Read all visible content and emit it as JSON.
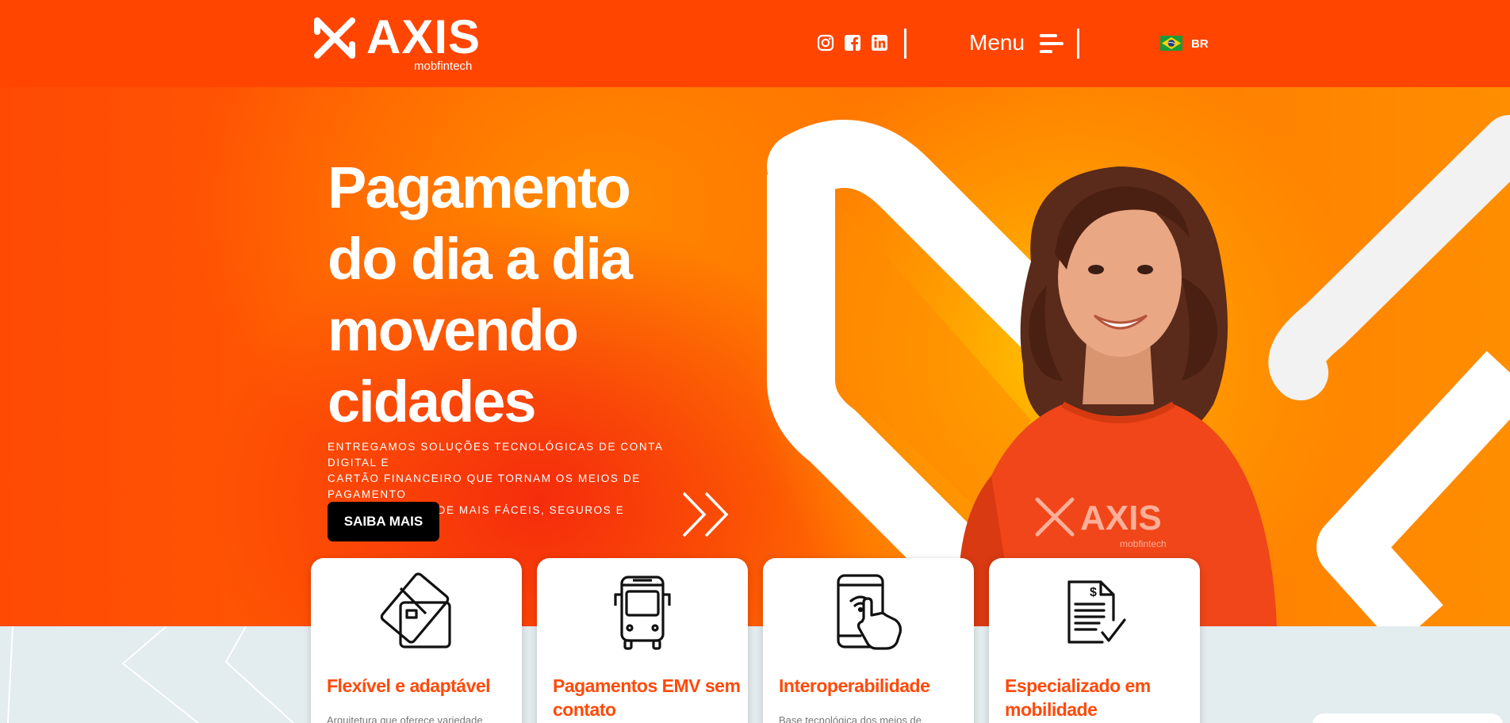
{
  "header": {
    "logo_text": "AXIS",
    "logo_subtitle": "mobfintech",
    "social": [
      "instagram-icon",
      "facebook-icon",
      "linkedin-icon"
    ],
    "menu_label": "Menu",
    "language": "BR",
    "language_flag": "brazil-flag-icon"
  },
  "hero": {
    "title_lines": [
      "Pagamento",
      "do dia a dia",
      "movendo",
      "cidades"
    ],
    "description_lines": [
      "ENTREGAMOS SOLUÇÕES TECNOLÓGICAS DE CONTA DIGITAL E",
      "CARTÃO FINANCEIRO QUE TORNAM OS MEIOS DE PAGAMENTO",
      "PARA A MOBILIDADE MAIS FÁCEIS, SEGUROS E EFICIENTES"
    ],
    "cta_label": "SAIBA MAIS",
    "shirt_logo_text": "AXIS",
    "shirt_logo_subtitle": "mobfintech"
  },
  "cards": [
    {
      "icon": "credit-cards-icon",
      "title_lines": [
        "Flexível e adaptável"
      ],
      "description": "Arquitetura que oferece variedade"
    },
    {
      "icon": "bus-icon",
      "title_lines": [
        "Pagamentos EMV sem",
        "contato"
      ],
      "description": ""
    },
    {
      "icon": "contactless-phone-icon",
      "title_lines": [
        "Interoperabilidade"
      ],
      "description": "Base tecnológica dos meios de"
    },
    {
      "icon": "invoice-check-icon",
      "title_lines": [
        "Especializado em",
        "mobilidade"
      ],
      "description": ""
    }
  ],
  "colors": {
    "brand_orange": "#ff4500",
    "card_title": "#ff4a0a",
    "cta_bg": "#000000",
    "bottom_bg": "#e3ecef"
  }
}
